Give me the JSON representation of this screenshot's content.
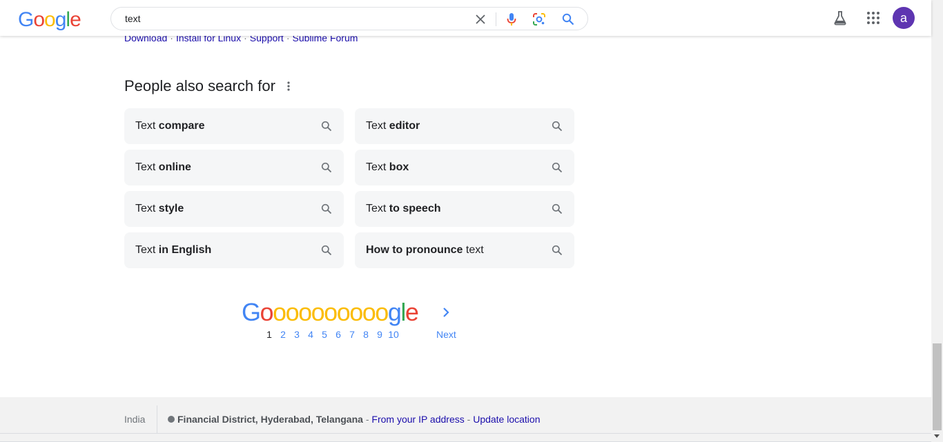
{
  "header": {
    "logo_letters": [
      {
        "ch": "G",
        "color": "#4285f4"
      },
      {
        "ch": "o",
        "color": "#ea4335"
      },
      {
        "ch": "o",
        "color": "#fbbc05"
      },
      {
        "ch": "g",
        "color": "#4285f4"
      },
      {
        "ch": "l",
        "color": "#34a853"
      },
      {
        "ch": "e",
        "color": "#ea4335"
      }
    ],
    "search_value": "text",
    "avatar_letter": "a",
    "avatar_color": "#5e35b1"
  },
  "sitelinks": [
    "Download",
    "Install for Linux",
    "Support",
    "Sublime Forum"
  ],
  "sitelink_separator": "·",
  "people_also_search": {
    "title": "People also search for",
    "items": [
      {
        "pre": "Text ",
        "bold": "compare",
        "post": ""
      },
      {
        "pre": "Text ",
        "bold": "editor",
        "post": ""
      },
      {
        "pre": "Text ",
        "bold": "online",
        "post": ""
      },
      {
        "pre": "Text ",
        "bold": "box",
        "post": ""
      },
      {
        "pre": "Text ",
        "bold": "style",
        "post": ""
      },
      {
        "pre": "Text ",
        "bold": "to speech",
        "post": ""
      },
      {
        "pre": "Text ",
        "bold": "in English",
        "post": ""
      },
      {
        "pre": "",
        "bold": "How to pronounce",
        "post": " text"
      }
    ]
  },
  "pagination": {
    "logo_letters": [
      {
        "ch": "G",
        "color": "#4285f4"
      },
      {
        "ch": "o",
        "color": "#ea4335"
      },
      {
        "ch": "o",
        "color": "#fbbc05"
      },
      {
        "ch": "o",
        "color": "#fbbc05"
      },
      {
        "ch": "o",
        "color": "#fbbc05"
      },
      {
        "ch": "o",
        "color": "#fbbc05"
      },
      {
        "ch": "o",
        "color": "#fbbc05"
      },
      {
        "ch": "o",
        "color": "#fbbc05"
      },
      {
        "ch": "o",
        "color": "#fbbc05"
      },
      {
        "ch": "o",
        "color": "#fbbc05"
      },
      {
        "ch": "o",
        "color": "#fbbc05"
      },
      {
        "ch": "g",
        "color": "#4285f4"
      },
      {
        "ch": "l",
        "color": "#34a853"
      },
      {
        "ch": "e",
        "color": "#ea4335"
      }
    ],
    "pages": [
      "1",
      "2",
      "3",
      "4",
      "5",
      "6",
      "7",
      "8",
      "9",
      "10"
    ],
    "current_page": "1",
    "next_label": "Next"
  },
  "footer": {
    "country": "India",
    "location": "Financial District, Hyderabad, Telangana",
    "dash1": " - ",
    "ip_link": "From your IP address",
    "dash2": " - ",
    "update_link": "Update location"
  },
  "colors": {
    "link": "#1a0dab",
    "accent_blue": "#4285f4",
    "chip_bg": "#f5f6f7"
  }
}
